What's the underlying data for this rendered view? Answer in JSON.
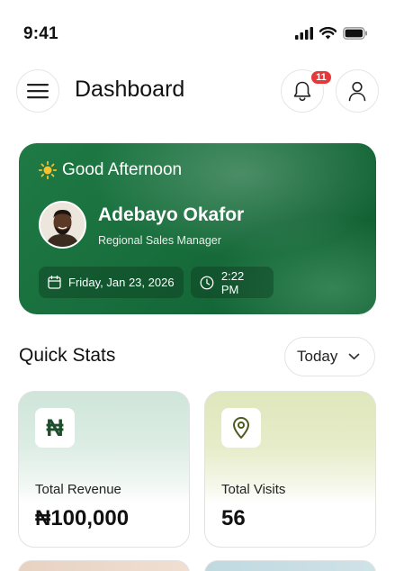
{
  "status_bar": {
    "time": "9:41"
  },
  "header": {
    "title": "Dashboard",
    "notification_count": "11"
  },
  "greeting": {
    "text": "Good Afternoon",
    "name": "Adebayo Okafor",
    "role": "Regional Sales Manager",
    "date": "Friday, Jan 23, 2026",
    "time": "2:22 PM"
  },
  "quick_stats": {
    "title": "Quick Stats",
    "period": "Today",
    "cards": [
      {
        "label": "Total Revenue",
        "value": "₦100,000",
        "icon": "naira-icon",
        "glyph": "₦"
      },
      {
        "label": "Total Visits",
        "value": "56",
        "icon": "location-pin-icon"
      }
    ]
  },
  "colors": {
    "card_green": "#186e3c",
    "badge_red": "#e5383b",
    "revenue_tint": "#cfe5da",
    "visits_tint": "#dfe7bd",
    "icon_dark_green": "#1d4f2c",
    "pin_olive": "#4d5a1e"
  }
}
